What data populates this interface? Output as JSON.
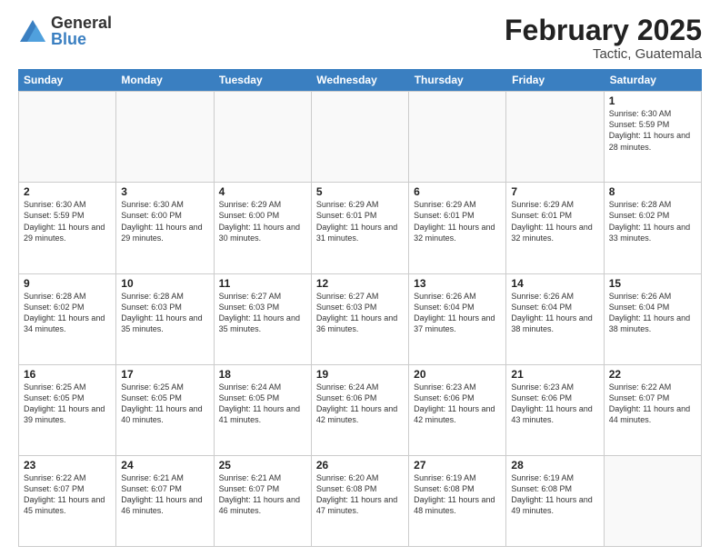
{
  "logo": {
    "general": "General",
    "blue": "Blue"
  },
  "title": "February 2025",
  "location": "Tactic, Guatemala",
  "header_days": [
    "Sunday",
    "Monday",
    "Tuesday",
    "Wednesday",
    "Thursday",
    "Friday",
    "Saturday"
  ],
  "weeks": [
    [
      {
        "day": "",
        "info": ""
      },
      {
        "day": "",
        "info": ""
      },
      {
        "day": "",
        "info": ""
      },
      {
        "day": "",
        "info": ""
      },
      {
        "day": "",
        "info": ""
      },
      {
        "day": "",
        "info": ""
      },
      {
        "day": "1",
        "info": "Sunrise: 6:30 AM\nSunset: 5:59 PM\nDaylight: 11 hours\nand 28 minutes."
      }
    ],
    [
      {
        "day": "2",
        "info": "Sunrise: 6:30 AM\nSunset: 5:59 PM\nDaylight: 11 hours\nand 29 minutes."
      },
      {
        "day": "3",
        "info": "Sunrise: 6:30 AM\nSunset: 6:00 PM\nDaylight: 11 hours\nand 29 minutes."
      },
      {
        "day": "4",
        "info": "Sunrise: 6:29 AM\nSunset: 6:00 PM\nDaylight: 11 hours\nand 30 minutes."
      },
      {
        "day": "5",
        "info": "Sunrise: 6:29 AM\nSunset: 6:01 PM\nDaylight: 11 hours\nand 31 minutes."
      },
      {
        "day": "6",
        "info": "Sunrise: 6:29 AM\nSunset: 6:01 PM\nDaylight: 11 hours\nand 32 minutes."
      },
      {
        "day": "7",
        "info": "Sunrise: 6:29 AM\nSunset: 6:01 PM\nDaylight: 11 hours\nand 32 minutes."
      },
      {
        "day": "8",
        "info": "Sunrise: 6:28 AM\nSunset: 6:02 PM\nDaylight: 11 hours\nand 33 minutes."
      }
    ],
    [
      {
        "day": "9",
        "info": "Sunrise: 6:28 AM\nSunset: 6:02 PM\nDaylight: 11 hours\nand 34 minutes."
      },
      {
        "day": "10",
        "info": "Sunrise: 6:28 AM\nSunset: 6:03 PM\nDaylight: 11 hours\nand 35 minutes."
      },
      {
        "day": "11",
        "info": "Sunrise: 6:27 AM\nSunset: 6:03 PM\nDaylight: 11 hours\nand 35 minutes."
      },
      {
        "day": "12",
        "info": "Sunrise: 6:27 AM\nSunset: 6:03 PM\nDaylight: 11 hours\nand 36 minutes."
      },
      {
        "day": "13",
        "info": "Sunrise: 6:26 AM\nSunset: 6:04 PM\nDaylight: 11 hours\nand 37 minutes."
      },
      {
        "day": "14",
        "info": "Sunrise: 6:26 AM\nSunset: 6:04 PM\nDaylight: 11 hours\nand 38 minutes."
      },
      {
        "day": "15",
        "info": "Sunrise: 6:26 AM\nSunset: 6:04 PM\nDaylight: 11 hours\nand 38 minutes."
      }
    ],
    [
      {
        "day": "16",
        "info": "Sunrise: 6:25 AM\nSunset: 6:05 PM\nDaylight: 11 hours\nand 39 minutes."
      },
      {
        "day": "17",
        "info": "Sunrise: 6:25 AM\nSunset: 6:05 PM\nDaylight: 11 hours\nand 40 minutes."
      },
      {
        "day": "18",
        "info": "Sunrise: 6:24 AM\nSunset: 6:05 PM\nDaylight: 11 hours\nand 41 minutes."
      },
      {
        "day": "19",
        "info": "Sunrise: 6:24 AM\nSunset: 6:06 PM\nDaylight: 11 hours\nand 42 minutes."
      },
      {
        "day": "20",
        "info": "Sunrise: 6:23 AM\nSunset: 6:06 PM\nDaylight: 11 hours\nand 42 minutes."
      },
      {
        "day": "21",
        "info": "Sunrise: 6:23 AM\nSunset: 6:06 PM\nDaylight: 11 hours\nand 43 minutes."
      },
      {
        "day": "22",
        "info": "Sunrise: 6:22 AM\nSunset: 6:07 PM\nDaylight: 11 hours\nand 44 minutes."
      }
    ],
    [
      {
        "day": "23",
        "info": "Sunrise: 6:22 AM\nSunset: 6:07 PM\nDaylight: 11 hours\nand 45 minutes."
      },
      {
        "day": "24",
        "info": "Sunrise: 6:21 AM\nSunset: 6:07 PM\nDaylight: 11 hours\nand 46 minutes."
      },
      {
        "day": "25",
        "info": "Sunrise: 6:21 AM\nSunset: 6:07 PM\nDaylight: 11 hours\nand 46 minutes."
      },
      {
        "day": "26",
        "info": "Sunrise: 6:20 AM\nSunset: 6:08 PM\nDaylight: 11 hours\nand 47 minutes."
      },
      {
        "day": "27",
        "info": "Sunrise: 6:19 AM\nSunset: 6:08 PM\nDaylight: 11 hours\nand 48 minutes."
      },
      {
        "day": "28",
        "info": "Sunrise: 6:19 AM\nSunset: 6:08 PM\nDaylight: 11 hours\nand 49 minutes."
      },
      {
        "day": "",
        "info": ""
      }
    ]
  ]
}
